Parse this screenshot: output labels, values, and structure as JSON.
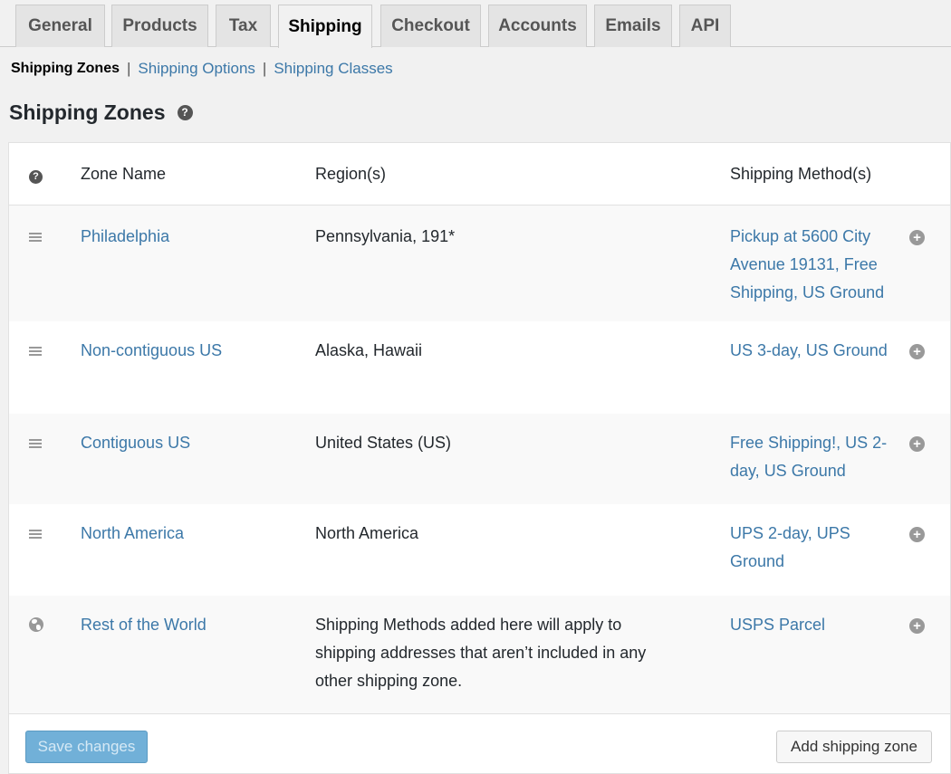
{
  "tabs": [
    {
      "label": "General",
      "active": false
    },
    {
      "label": "Products",
      "active": false
    },
    {
      "label": "Tax",
      "active": false
    },
    {
      "label": "Shipping",
      "active": true
    },
    {
      "label": "Checkout",
      "active": false
    },
    {
      "label": "Accounts",
      "active": false
    },
    {
      "label": "Emails",
      "active": false
    },
    {
      "label": "API",
      "active": false
    }
  ],
  "subnav": {
    "current": "Shipping Zones",
    "separator": "|",
    "links": [
      "Shipping Options",
      "Shipping Classes"
    ]
  },
  "page_title": "Shipping Zones",
  "help_glyph": "?",
  "table": {
    "headers": {
      "zone_name": "Zone Name",
      "regions": "Region(s)",
      "methods": "Shipping Method(s)"
    },
    "rows": [
      {
        "icon": "drag-handle-icon",
        "name": "Philadelphia",
        "region": "Pennsylvania, 191*",
        "methods": "Pickup at 5600 City Avenue 19131, Free Shipping, US Ground"
      },
      {
        "icon": "drag-handle-icon",
        "name": "Non-contiguous US",
        "region": "Alaska, Hawaii",
        "methods": "US 3-day, US Ground"
      },
      {
        "icon": "drag-handle-icon",
        "name": "Contiguous US",
        "region": "United States (US)",
        "methods": "Free Shipping!, US 2-day, US Ground"
      },
      {
        "icon": "drag-handle-icon",
        "name": "North America",
        "region": "North America",
        "methods": "UPS 2-day, UPS Ground"
      },
      {
        "icon": "globe-icon",
        "name": "Rest of the World",
        "region": "Shipping Methods added here will apply to shipping addresses that aren’t included in any other shipping zone.",
        "methods": "USPS Parcel"
      }
    ],
    "add_glyph": "+"
  },
  "footer": {
    "save_label": "Save changes",
    "add_zone_label": "Add shipping zone"
  },
  "colors": {
    "link": "#3c78a8",
    "primary_button": "#71b0d8",
    "background": "#f1f1f1"
  }
}
